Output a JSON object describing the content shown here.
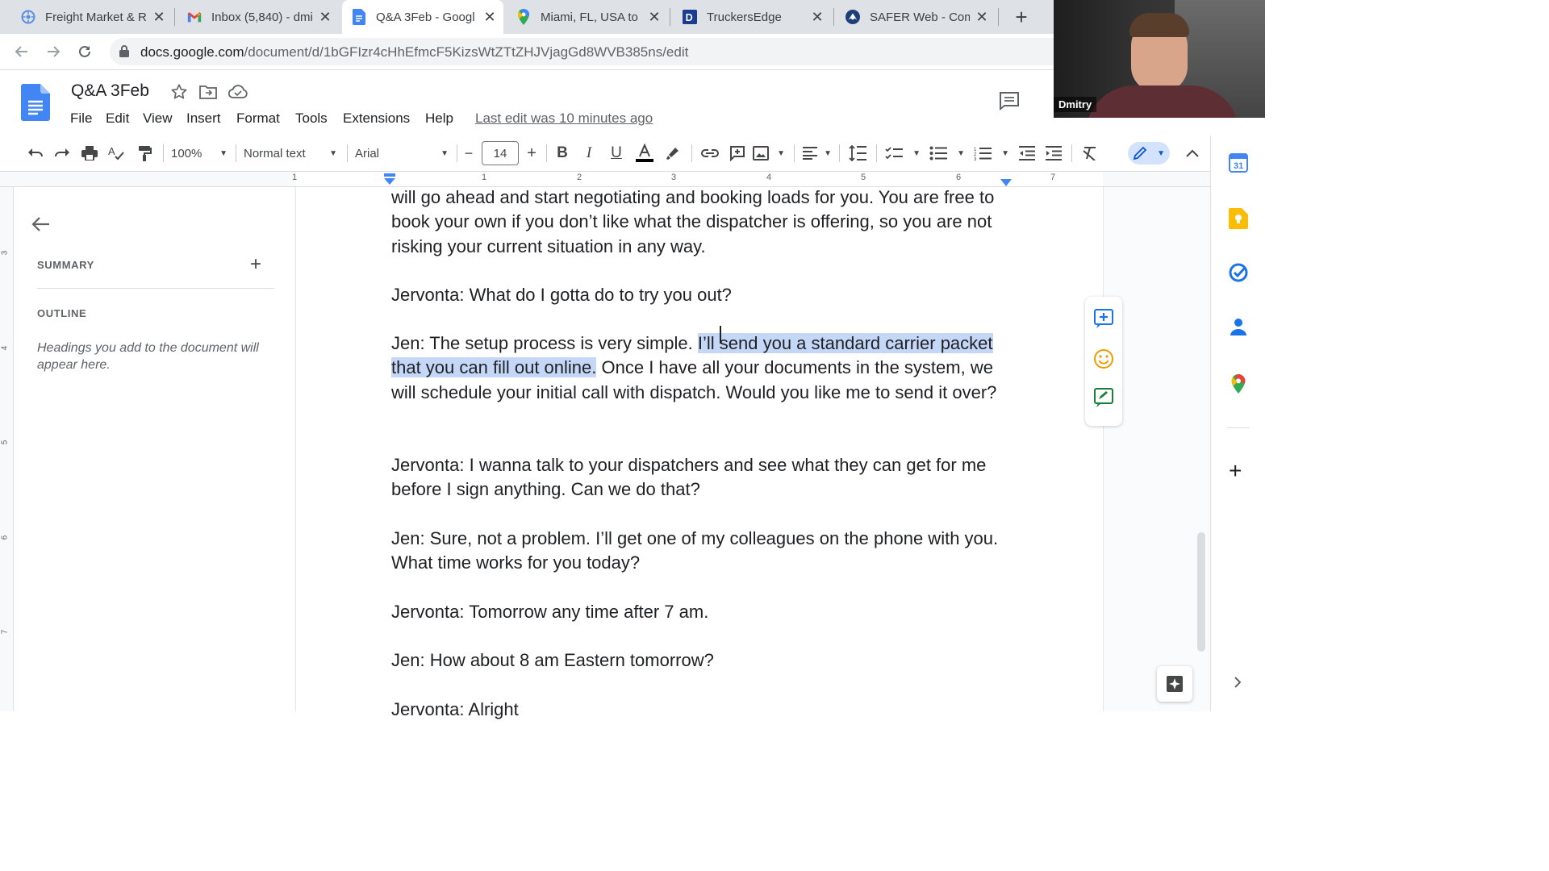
{
  "browser": {
    "tabs": [
      {
        "title": "Freight Market & R",
        "icon": "freight-market-icon"
      },
      {
        "title": "Inbox (5,840) - dmi",
        "icon": "gmail-icon"
      },
      {
        "title": "Q&A 3Feb - Googl",
        "icon": "google-docs-icon"
      },
      {
        "title": "Miami, FL, USA to E",
        "icon": "google-maps-icon"
      },
      {
        "title": "TruckersEdge",
        "icon": "truckersedge-icon"
      },
      {
        "title": "SAFER Web - Comp",
        "icon": "safer-web-icon"
      }
    ],
    "url_host": "docs.google.com",
    "url_path": "/document/d/1bGFIzr4cHhEfmcF5KizsWtZTtZHJVjagGd8WVB385ns/edit"
  },
  "docs": {
    "title": "Q&A 3Feb",
    "menus": [
      "File",
      "Edit",
      "View",
      "Insert",
      "Format",
      "Tools",
      "Extensions",
      "Help"
    ],
    "last_edit": "Last edit was 10 minutes ago",
    "toolbar": {
      "zoom": "100%",
      "style": "Normal text",
      "font": "Arial",
      "font_size": "14",
      "minus": "−",
      "plus": "+"
    },
    "ruler_numbers": [
      "1",
      "1",
      "2",
      "3",
      "4",
      "5",
      "6",
      "7"
    ],
    "vruler_numbers": [
      "3",
      "4",
      "5",
      "6",
      "7"
    ]
  },
  "outline": {
    "summary_label": "SUMMARY",
    "outline_label": "OUTLINE",
    "hint": "Headings you add to the document will appear here."
  },
  "document": {
    "p1": "will go ahead and start negotiating and booking loads for you. You are free to book your own if you don’t like what the dispatcher is offering, so you are not risking your current situation in any way.",
    "p2": "Jervonta: What do I gotta do to try you out?",
    "p3_before": "Jen: The setup process is very simple. ",
    "p3_selected": "I’ll send you a standard carrier packet that you can fill out online.",
    "p3_after": " Once I have all your documents in the system, we will schedule your initial call with dispatch. Would you like me to send it over?",
    "p4": "Jervonta: I wanna talk to your dispatchers and see what they can get for me before I sign anything. Can we do that?",
    "p5": "Jen: Sure, not a problem. I’ll get one of my colleagues on the phone with you. What time works for you today?",
    "p6": "Jervonta: Tomorrow any time after 7 am.",
    "p7": "Jen: How about 8 am Eastern tomorrow?",
    "p8": "Jervonta: Alright"
  },
  "webcam": {
    "name": "Dmitry"
  }
}
